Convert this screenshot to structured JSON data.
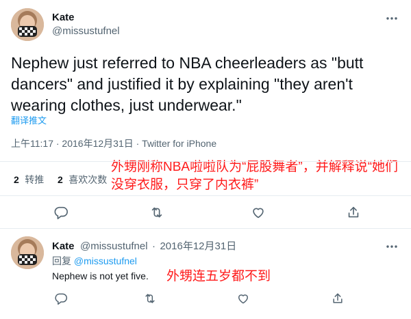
{
  "main_tweet": {
    "author_name": "Kate",
    "author_handle": "@missustufnel",
    "text": "Nephew just referred to NBA cheerleaders as \"butt dancers\" and justified it by explaining \"they aren't wearing clothes, just underwear.\"",
    "translate_label": "翻译推文",
    "timestamp": "上午11:17 · 2016年12月31日 · Twitter for iPhone",
    "retweets_count": "2",
    "retweets_label": "转推",
    "likes_count": "2",
    "likes_label": "喜欢次数"
  },
  "annotation_1": "外甥刚称NBA啦啦队为“屁股舞者”，并解释说“她们没穿衣服，只穿了内衣裤”",
  "reply_tweet": {
    "author_name": "Kate",
    "author_handle": "@missustufnel",
    "dot": "·",
    "date": "2016年12月31日",
    "reply_prefix": "回复",
    "reply_to": "@missustufnel",
    "text": "Nephew is not yet five."
  },
  "annotation_2": "外甥连五岁都不到",
  "icons": [
    "avatar",
    "more-icon",
    "reply-icon",
    "retweet-icon",
    "like-icon",
    "share-icon"
  ],
  "colors": {
    "link": "#1d9bf0",
    "annotation": "#ff1a1a",
    "secondary_text": "#536471"
  }
}
